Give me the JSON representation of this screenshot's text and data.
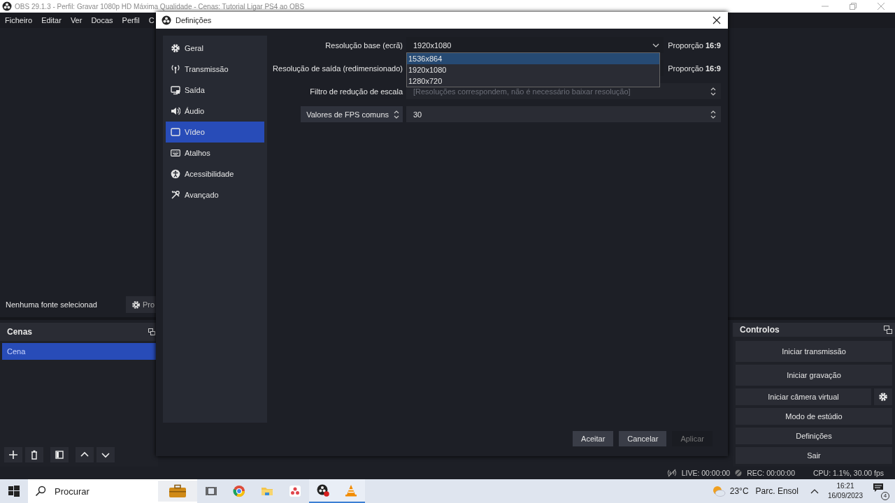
{
  "main_window": {
    "title": "OBS 29.1.3 - Perfil: Gravar 1080p HD Máxima Qualidade - Cenas: Tutorial Ligar PS4 ao OBS"
  },
  "menu": [
    "Ficheiro",
    "Editar",
    "Ver",
    "Docas",
    "Perfil",
    "C"
  ],
  "source_bar": {
    "label": "Nenhuma fonte selecionad",
    "properties_button": "Pro"
  },
  "scenes_dock": {
    "title": "Cenas",
    "items": [
      {
        "label": "Cena",
        "selected": true
      }
    ]
  },
  "controls_dock": {
    "title": "Controlos",
    "buttons": [
      {
        "label": "Iniciar transmissão",
        "kind": "plain"
      },
      {
        "label": "Iniciar gravação",
        "kind": "plain"
      },
      {
        "label": "Iniciar câmera virtual",
        "kind": "with_settings"
      },
      {
        "label": "Modo de estúdio",
        "kind": "plain"
      },
      {
        "label": "Definições",
        "kind": "plain"
      },
      {
        "label": "Sair",
        "kind": "plain"
      }
    ]
  },
  "status_bar": {
    "live": "LIVE: 00:00:00",
    "rec": "REC: 00:00:00",
    "cpu": "CPU: 1.1%, 30.00 fps"
  },
  "settings_dialog": {
    "title": "Definições",
    "sidebar": [
      {
        "label": "Geral",
        "selected": false
      },
      {
        "label": "Transmissão",
        "selected": false
      },
      {
        "label": "Saída",
        "selected": false
      },
      {
        "label": "Áudio",
        "selected": false
      },
      {
        "label": "Vídeo",
        "selected": true
      },
      {
        "label": "Atalhos",
        "selected": false
      },
      {
        "label": "Acessibilidade",
        "selected": false
      },
      {
        "label": "Avançado",
        "selected": false
      }
    ],
    "rows": [
      {
        "kind": "text_label",
        "label": "Resolução base (ecrã)",
        "value": "1920x1080",
        "disabled": false,
        "aspect": "Proporção **16:9**"
      },
      {
        "kind": "text_label",
        "label": "Resolução de saída (redimensionado)",
        "value": "",
        "disabled": false,
        "aspect": "Proporção **16:9**"
      },
      {
        "kind": "text_label",
        "label": "Filtro de redução de escala",
        "value": "[Resoluções correspondem, não é necessário baixar resolução]",
        "disabled": true
      },
      {
        "kind": "combo_label",
        "label": "Valores de FPS comuns",
        "value": "30",
        "disabled": false
      }
    ],
    "dropdown": {
      "options": [
        {
          "label": "1536x864",
          "selected": true
        },
        {
          "label": "1920x1080",
          "selected": false
        },
        {
          "label": "1280x720",
          "selected": false
        }
      ]
    },
    "buttons": [
      {
        "label": "Aceitar",
        "disabled": false
      },
      {
        "label": "Cancelar",
        "disabled": false
      },
      {
        "label": "Aplicar",
        "disabled": true
      }
    ]
  },
  "taskbar": {
    "search": {
      "placeholder": "Procurar"
    },
    "temperature": "23°C",
    "weather": "Parc. Ensol",
    "time": "16:21",
    "date": "16/09/2023",
    "notifications": "4"
  }
}
